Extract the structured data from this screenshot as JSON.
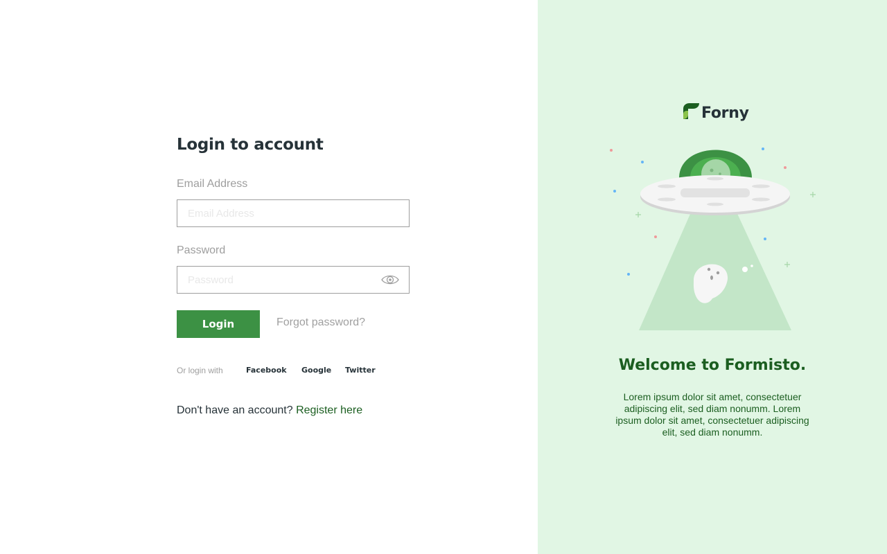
{
  "login": {
    "title": "Login to account",
    "email_label": "Email Address",
    "email_placeholder": "Email Address",
    "email_value": "",
    "password_label": "Password",
    "password_placeholder": "Password",
    "password_value": "",
    "password_toggle_icon": "eye-icon",
    "login_button": "Login",
    "forgot_password": "Forgot password?",
    "social_prefix": "Or login with",
    "social": [
      "Facebook",
      "Google",
      "Twitter"
    ],
    "register_prompt": "Don't have an account?",
    "register_link": "Register here"
  },
  "brand": {
    "name": "Forny",
    "logo_icon": "leaf-logo-icon",
    "welcome_title": "Welcome to Formisto.",
    "welcome_text": "Lorem ipsum dolor sit amet, consectetuer adipiscing elit, sed diam nonumm. Lorem ipsum dolor sit amet, consectetuer adipiscing elit, sed diam nonumm.",
    "illustration": "ufo-ghost-illustration"
  },
  "colors": {
    "primary": "#3c9144",
    "dark_green": "#1b5e20",
    "panel_background": "#e1f6e4",
    "text_dark": "#263238",
    "muted": "#9e9e9e"
  }
}
